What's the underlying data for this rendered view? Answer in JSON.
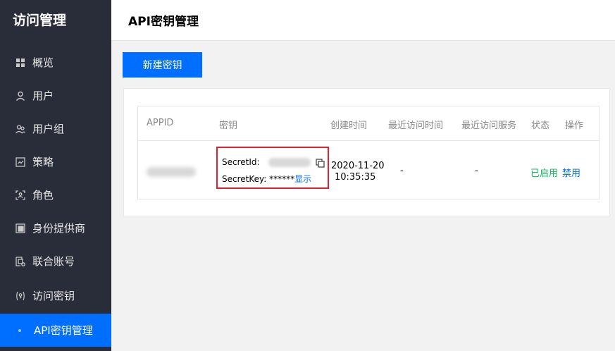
{
  "sidebar": {
    "title": "访问管理",
    "items": [
      {
        "label": "概览",
        "icon": "grid-icon"
      },
      {
        "label": "用户",
        "icon": "user-icon"
      },
      {
        "label": "用户组",
        "icon": "user-group-icon"
      },
      {
        "label": "策略",
        "icon": "policy-icon"
      },
      {
        "label": "角色",
        "icon": "role-icon"
      },
      {
        "label": "身份提供商",
        "icon": "identity-provider-icon"
      },
      {
        "label": "联合账号",
        "icon": "federated-account-icon"
      },
      {
        "label": "访问密钥",
        "icon": "key-icon"
      }
    ],
    "active_sub": "API密钥管理"
  },
  "header": {
    "title": "API密钥管理"
  },
  "toolbar": {
    "create_label": "新建密钥"
  },
  "table": {
    "columns": [
      "APPID",
      "密钥",
      "创建时间",
      "最近访问时间",
      "最近访问服务",
      "状态",
      "操作"
    ],
    "row": {
      "secret_id_label": "SecretId:",
      "secret_key_label": "SecretKey: ******",
      "show_label": "显示",
      "created_date": "2020-11-20",
      "created_time": "10:35:35",
      "last_access_time": "-",
      "last_access_service": "-",
      "status": "已启用",
      "action": "禁用"
    }
  },
  "colors": {
    "sidebar_bg": "#292d39",
    "accent": "#006eff",
    "status_green": "#0abf5b",
    "highlight_red": "#e0202e"
  }
}
